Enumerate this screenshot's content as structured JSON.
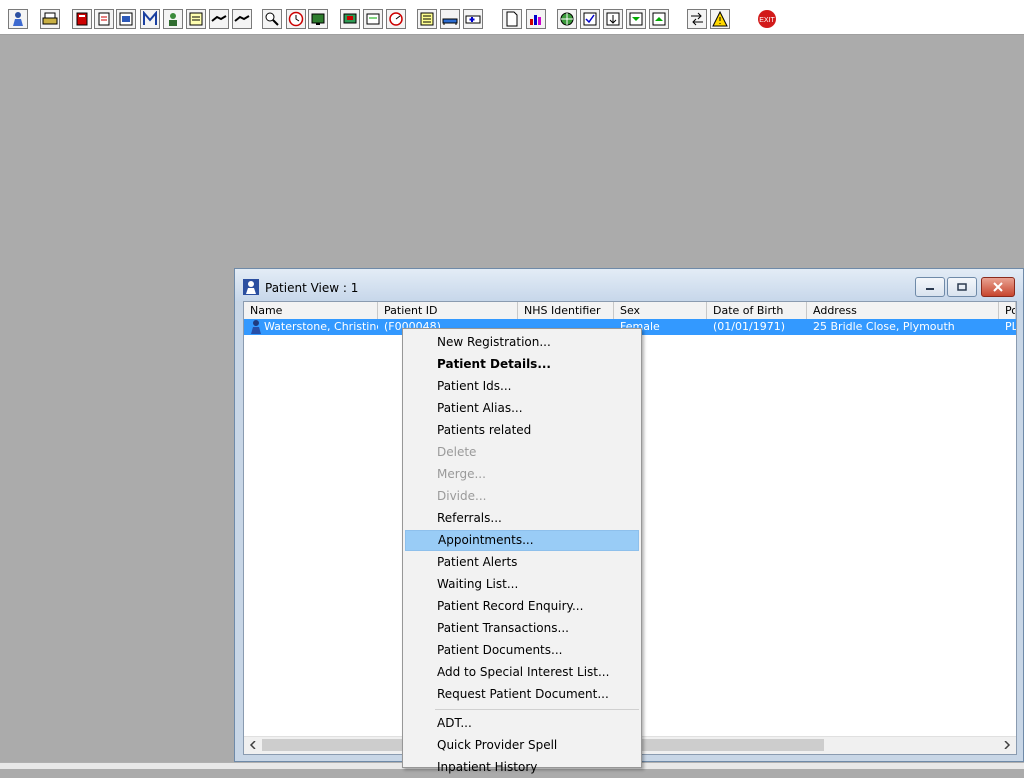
{
  "window": {
    "title": "Patient View : 1"
  },
  "table": {
    "columns": [
      "Name",
      "Patient ID",
      "NHS Identifier",
      "Sex",
      "Date of Birth",
      "Address",
      "Po"
    ],
    "rows": [
      {
        "name": "Waterstone, Christine...",
        "patient_id": "(F000048)",
        "nhs_identifier": "",
        "sex": "Female",
        "dob": "(01/01/1971)",
        "address": "25 Bridle Close, Plymouth",
        "po": "PL"
      }
    ]
  },
  "context_menu": {
    "items": [
      {
        "label": "New Registration...",
        "state": "normal"
      },
      {
        "label": "Patient Details...",
        "state": "bold"
      },
      {
        "label": "Patient Ids...",
        "state": "normal"
      },
      {
        "label": "Patient Alias...",
        "state": "normal"
      },
      {
        "label": "Patients related",
        "state": "normal"
      },
      {
        "label": "Delete",
        "state": "disabled"
      },
      {
        "label": "Merge...",
        "state": "disabled"
      },
      {
        "label": "Divide...",
        "state": "disabled"
      },
      {
        "label": "Referrals...",
        "state": "normal"
      },
      {
        "label": "Appointments...",
        "state": "highlighted"
      },
      {
        "label": "Patient Alerts",
        "state": "normal"
      },
      {
        "label": "Waiting List...",
        "state": "normal"
      },
      {
        "label": "Patient Record Enquiry...",
        "state": "normal"
      },
      {
        "label": "Patient Transactions...",
        "state": "normal"
      },
      {
        "label": "Patient Documents...",
        "state": "normal"
      },
      {
        "label": "Add to Special Interest List...",
        "state": "normal"
      },
      {
        "label": "Request Patient Document...",
        "state": "normal"
      },
      {
        "label": "ADT...",
        "state": "normal"
      },
      {
        "label": "Quick Provider Spell",
        "state": "normal"
      },
      {
        "label": "Inpatient History",
        "state": "normal"
      }
    ]
  },
  "toolbar": {
    "icons": [
      "patient-icon",
      "printer-icon",
      "book-icon",
      "notepad-icon",
      "chart-icon",
      "m-letter-icon",
      "doctor-icon",
      "notes-icon",
      "handshake-icon",
      "handshake-icon",
      "magnify-icon",
      "clock-icon",
      "monitor-icon",
      "screen-icon",
      "card-icon",
      "dial-icon",
      "list-icon",
      "bed-icon",
      "ambulance-icon",
      "document-icon",
      "bar-chart-icon",
      "globe-icon",
      "check-list-icon",
      "down-arrow-icon",
      "green-arrow-icon",
      "green-arrow2-icon",
      "swap-icon",
      "warning-icon",
      "exit-icon"
    ],
    "exit_label": "EXIT"
  },
  "colors": {
    "desktop": "#ababab",
    "selection": "#3399ff",
    "menu_highlight": "#99ccf6"
  }
}
